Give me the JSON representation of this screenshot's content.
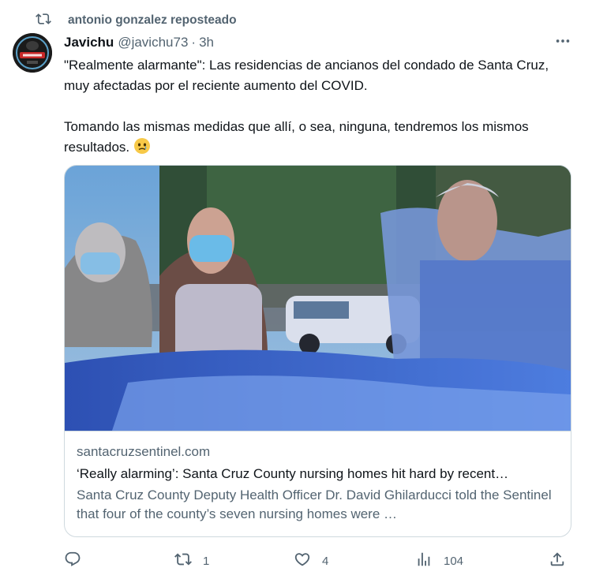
{
  "repost": {
    "text": "antonio gonzalez reposteado",
    "icon": "repost-icon"
  },
  "author": {
    "name": "Javichu",
    "handle": "@javichu73",
    "separator": "·",
    "time": "3h"
  },
  "menu": {
    "icon": "more-icon"
  },
  "tweet": {
    "paragraph1": "\"Realmente alarmante\": Las residencias de ancianos del condado de Santa Cruz, muy afectadas por el reciente aumento del COVID.",
    "paragraph2": "Tomando las mismas medidas que allí, o sea, ninguna, tendremos los mismos resultados.",
    "emoji": "face-holding-back-tears-emoji"
  },
  "card": {
    "domain": "santacruzsentinel.com",
    "title": "‘Really alarming’: Santa Cruz County nursing homes hit hard by recent…",
    "description": "Santa Cruz County Deputy Health Officer Dr. David Ghilarducci told the Sentinel that four of the county’s seven nursing homes were …",
    "image": "nursing-home-window-photo"
  },
  "actions": {
    "reply": {
      "icon": "reply-icon",
      "count": ""
    },
    "repost": {
      "icon": "repost-icon",
      "count": "1"
    },
    "like": {
      "icon": "heart-icon",
      "count": "4"
    },
    "views": {
      "icon": "views-icon",
      "count": "104"
    },
    "share": {
      "icon": "share-icon"
    }
  },
  "colors": {
    "text": "#0f1419",
    "muted": "#536471",
    "border": "#cfd9de",
    "background": "#ffffff"
  }
}
